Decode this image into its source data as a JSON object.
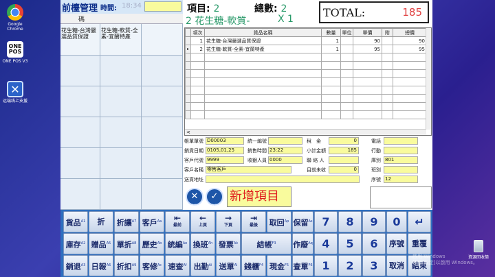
{
  "desktop": {
    "icons": [
      {
        "label": "Google Chrome",
        "icon": "chrome-icon"
      },
      {
        "label": "ONE POS V3",
        "icon": "onepos-icon"
      },
      {
        "label": "远端线上支援",
        "icon": "remote-support-icon"
      }
    ],
    "recycle_bin": "資源回收筒",
    "watermark": "啟用 Windows\n移至[設定]以啟用 Windows。"
  },
  "left_panel": {
    "title": "前檯管理",
    "time_label": "時間:",
    "time_value": "18:34",
    "column_header": "碼",
    "cells": [
      "花生糖-台灣嚴選品質保證",
      "花生糖-軟質-全素-宜蘭特產"
    ]
  },
  "header": {
    "item_label": "項目:",
    "item_value": "2",
    "count_label": "總數:",
    "count_value": "2",
    "current_line": "2  花生糖-軟質-",
    "current_qty": "X 1",
    "total_label": "TOTAL:",
    "total_value": "185"
  },
  "grid": {
    "columns": [
      "項次",
      "貨品名稱",
      "數量",
      "單位",
      "單價",
      "附",
      "總價"
    ],
    "rows": [
      {
        "no": "1",
        "name": "花生糖-台灣嚴選品質保證",
        "qty": "1",
        "unit": "",
        "price": "90",
        "add": "",
        "total": "90"
      },
      {
        "no": "2",
        "name": "花生糖-軟質-全素-宜蘭特產",
        "qty": "1",
        "unit": "",
        "price": "95",
        "add": "",
        "total": "95"
      }
    ],
    "hscroll_arrow": "<"
  },
  "info": {
    "account_no_label": "帳單單號",
    "account_no": "D00003",
    "tax_id_label": "統一編號",
    "tax_id": "",
    "sale_date_label": "銷貨日期",
    "sale_date": "0105,01,25",
    "sale_time_label": "銷售時間",
    "sale_time": "23:22",
    "customer_code_label": "客戶代號",
    "customer_code": "9999",
    "cashier_label": "收銀人員",
    "cashier": "0000",
    "customer_name_label": "客戶名稱",
    "customer_name": "零售客戶",
    "address_label": "送貨地址",
    "address": "",
    "tax_label": "稅　金",
    "tax": "0",
    "subtotal_label": "小計金額",
    "subtotal": "185",
    "contact_label": "聯 絡 人",
    "contact": "",
    "uncollected_label": "目前未收",
    "uncollected": "0",
    "phone_label": "電話",
    "phone": "",
    "mobile_label": "行動",
    "mobile": "",
    "station_label": "庫別",
    "station": "801",
    "shift_label": "班別",
    "shift": "",
    "serial_label": "序號",
    "serial": "12"
  },
  "actions": {
    "delete_label": "刪除",
    "modify_label": "修改",
    "new_item": "新增項目"
  },
  "keypad": {
    "row1": [
      {
        "label": "貨品",
        "sub": "A1"
      },
      {
        "label": "折扣%",
        "sub": "A4"
      },
      {
        "label": "折讓",
        "sub": "A7"
      },
      {
        "label": "客戶",
        "sub": "Aa"
      },
      {
        "label": "最前",
        "sub": "Ad"
      },
      {
        "label": "上頁",
        "sub": "Ag"
      },
      {
        "label": "下頁",
        "sub": "Aj"
      },
      {
        "label": "最後",
        "sub": "Am"
      },
      {
        "label": "取回",
        "sub": "Ap"
      },
      {
        "label": "保留",
        "sub": "As"
      }
    ],
    "row2": [
      {
        "label": "庫存",
        "sub": "A2"
      },
      {
        "label": "贈品",
        "sub": "A5"
      },
      {
        "label": "單折",
        "sub": "A8"
      },
      {
        "label": "歷史",
        "sub": "Ab"
      },
      {
        "label": "統編",
        "sub": "Ae"
      },
      {
        "label": "換班",
        "sub": "Ah"
      },
      {
        "label": "發票",
        "sub": "Ak"
      },
      {
        "label": "結帳",
        "sub": "F3"
      },
      {
        "label": "作廢",
        "sub": "Aq"
      }
    ],
    "row3": [
      {
        "label": "銷退",
        "sub": "A3"
      },
      {
        "label": "日報",
        "sub": "A6"
      },
      {
        "label": "折扣",
        "sub": "A9"
      },
      {
        "label": "客修",
        "sub": "Ac"
      },
      {
        "label": "速查",
        "sub": "Af"
      },
      {
        "label": "出勤",
        "sub": "Ai"
      },
      {
        "label": "送單",
        "sub": "Al"
      },
      {
        "label": "錢櫃",
        "sub": "F4"
      },
      {
        "label": "現金",
        "sub": "F5"
      },
      {
        "label": "查單",
        "sub": "F6"
      }
    ],
    "nums_row1": [
      "7",
      "8",
      "9",
      "0",
      "↵"
    ],
    "nums_row2": [
      "4",
      "5",
      "6",
      "序號",
      "重覆"
    ],
    "nums_row3": [
      "1",
      "2",
      "3",
      "取消",
      "結束"
    ]
  }
}
